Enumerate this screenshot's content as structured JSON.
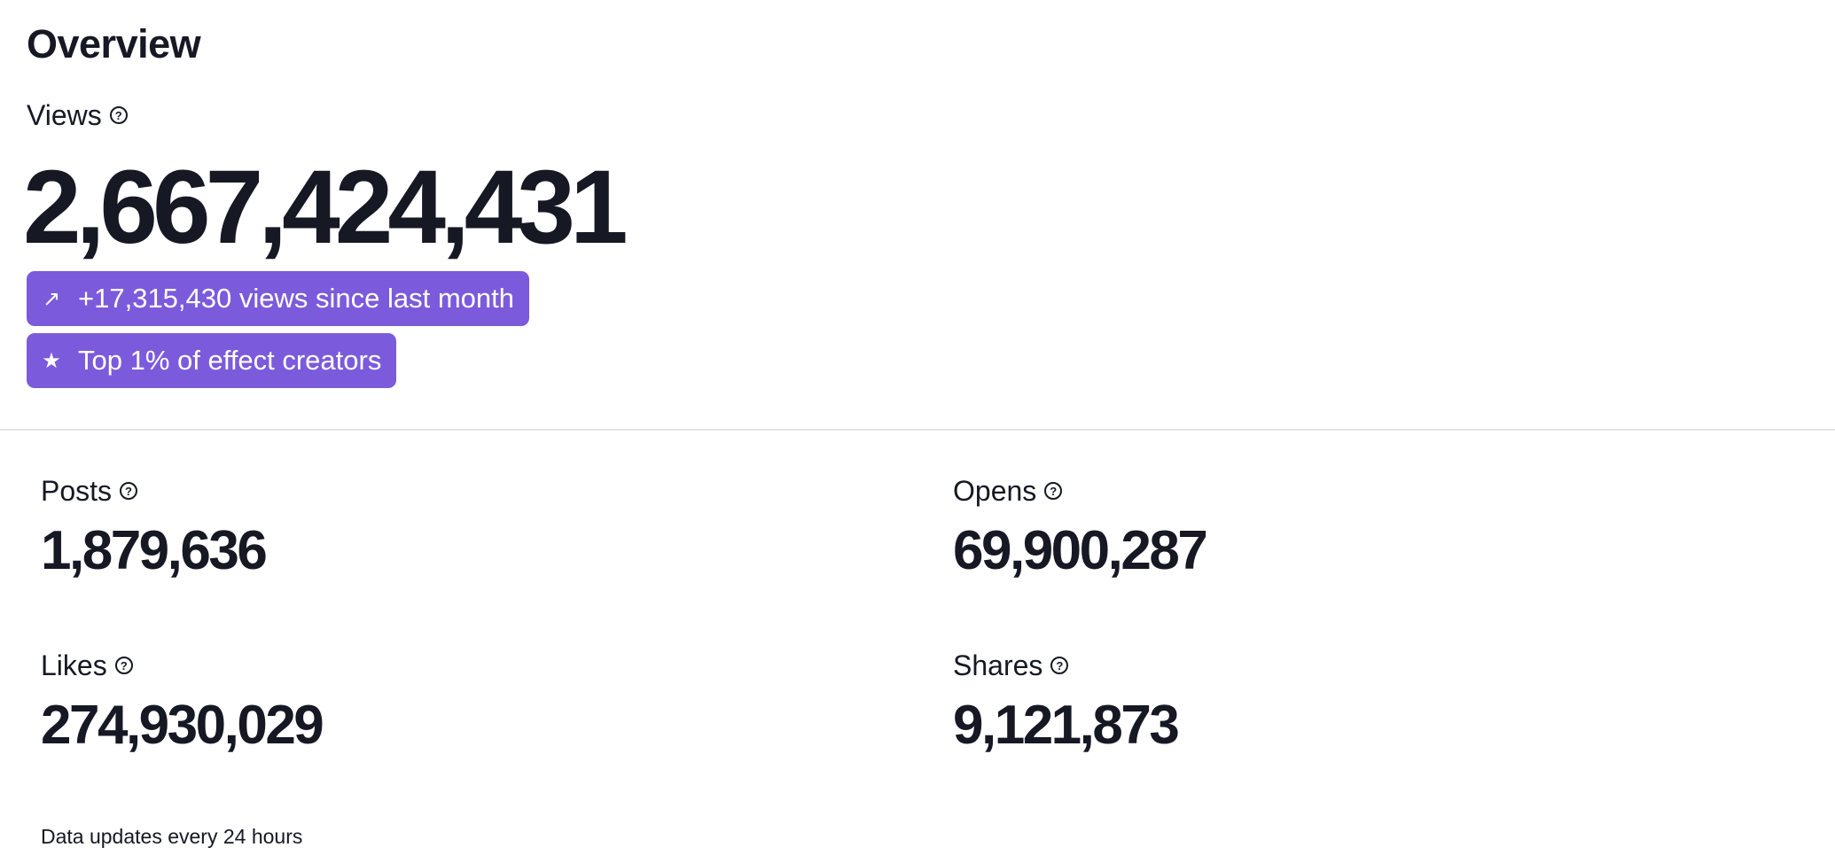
{
  "overview": {
    "title": "Overview"
  },
  "views": {
    "label": "Views",
    "value": "2,667,424,431",
    "change_icon": "arrow-up-right-icon",
    "change_text": "+17,315,430 views since last month",
    "rank_icon": "star-icon",
    "rank_text": "Top 1% of effect creators"
  },
  "stats": {
    "posts": {
      "label": "Posts",
      "value": "1,879,636"
    },
    "opens": {
      "label": "Opens",
      "value": "69,900,287"
    },
    "likes": {
      "label": "Likes",
      "value": "274,930,029"
    },
    "shares": {
      "label": "Shares",
      "value": "9,121,873"
    }
  },
  "footer": {
    "note": "Data updates every 24 hours"
  },
  "colors": {
    "accent": "#7b5bdb",
    "text": "#161823",
    "divider": "#e3e3e4"
  }
}
